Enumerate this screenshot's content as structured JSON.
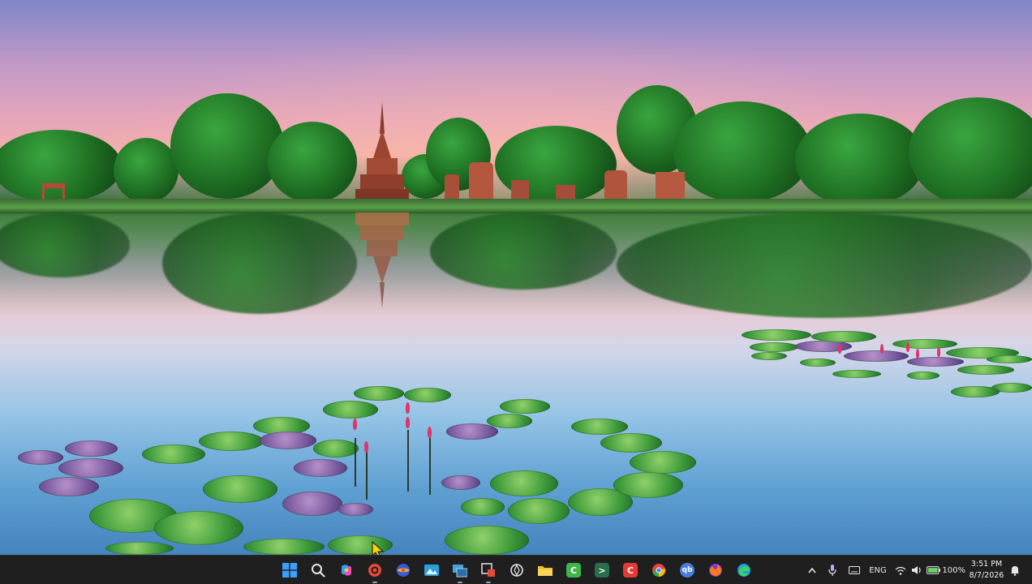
{
  "taskbar": {
    "pinned": [
      {
        "name": "start-button",
        "icon": "windows-logo-icon",
        "color": "#3aa0ff",
        "label": ""
      },
      {
        "name": "search-button",
        "icon": "search-icon",
        "color": "#e6e6e6",
        "label": ""
      },
      {
        "name": "copilot-button",
        "icon": "copilot-icon",
        "color": "#7a6cf0",
        "label": ""
      },
      {
        "name": "app-record",
        "icon": "record-icon",
        "color": "#e84a3a",
        "label": ""
      },
      {
        "name": "app-orb",
        "icon": "orb-icon",
        "color": "#3a5ad8",
        "label": ""
      },
      {
        "name": "app-photos",
        "icon": "photos-icon",
        "color": "#2a9fd8",
        "label": ""
      },
      {
        "name": "app-virtual-desktops",
        "icon": "windows-stack-icon",
        "color": "#4aa3d9",
        "label": ""
      },
      {
        "name": "app-snipping",
        "icon": "snipping-icon",
        "color": "#d8d8d8",
        "label": ""
      },
      {
        "name": "app-openai",
        "icon": "openai-icon",
        "color": "#e6e6e6",
        "label": ""
      },
      {
        "name": "app-file-explorer",
        "icon": "folder-icon",
        "color": "#f2c12e",
        "label": ""
      },
      {
        "name": "app-camtasia",
        "icon": "c-green-icon",
        "color": "#3fb54a",
        "label": "C"
      },
      {
        "name": "app-terminal",
        "icon": "terminal-icon",
        "color": "#2a6e4a",
        "label": ">"
      },
      {
        "name": "app-camtasia-red",
        "icon": "c-red-icon",
        "color": "#e53935",
        "label": "C"
      },
      {
        "name": "app-chrome",
        "icon": "chrome-icon",
        "color": "#e8453c",
        "label": ""
      },
      {
        "name": "app-qbittorrent",
        "icon": "qbittorrent-icon",
        "color": "#4a7fd8",
        "label": "qb"
      },
      {
        "name": "app-firefox",
        "icon": "firefox-icon",
        "color": "#ff7a1a",
        "label": ""
      },
      {
        "name": "app-edge",
        "icon": "edge-icon",
        "color": "#1fa0d8",
        "label": ""
      }
    ],
    "tray": {
      "overflow_icon": "chevron-up-icon",
      "mic_icon": "microphone-icon",
      "keyboard_icon": "keyboard-icon",
      "language": "ENG",
      "wifi_icon": "wifi-icon",
      "volume_icon": "speaker-icon",
      "battery_icon": "battery-icon",
      "battery_percent": "100%",
      "notification_icon": "bell-icon"
    },
    "clock": {
      "time": "3:51 PM",
      "date": "8/7/2026"
    }
  },
  "desktop": {
    "wallpaper": "lake-temple-lotus"
  }
}
